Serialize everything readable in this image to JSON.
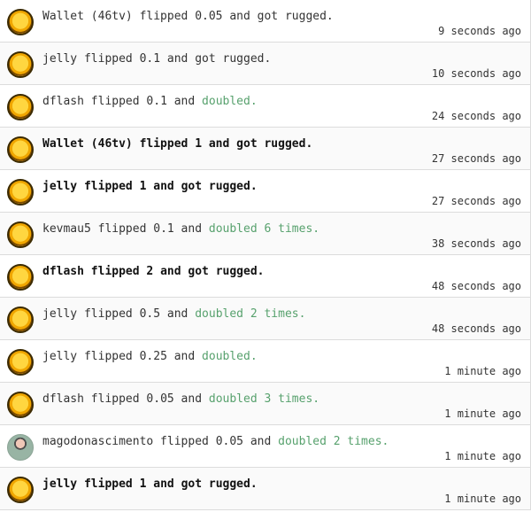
{
  "colors": {
    "doubled_text": "#57a16d",
    "coin": "#ffc21a",
    "divider": "#dcdcdc"
  },
  "feed": [
    {
      "icon": "coin-icon",
      "user": "Wallet (46tv)",
      "amount": "0.05",
      "verb_pre": " flipped ",
      "connector": " and ",
      "outcome": "got rugged.",
      "outcome_type": "rugged",
      "emphasis": false,
      "time": "9 seconds ago"
    },
    {
      "icon": "coin-icon",
      "user": "jelly",
      "amount": "0.1",
      "verb_pre": " flipped ",
      "connector": " and ",
      "outcome": "got rugged.",
      "outcome_type": "rugged",
      "emphasis": false,
      "time": "10 seconds ago"
    },
    {
      "icon": "coin-icon",
      "user": "dflash",
      "amount": "0.1",
      "verb_pre": " flipped ",
      "connector": " and ",
      "outcome": "doubled.",
      "outcome_type": "doubled",
      "emphasis": false,
      "time": "24 seconds ago"
    },
    {
      "icon": "coin-icon",
      "user": "Wallet (46tv)",
      "amount": "1",
      "verb_pre": " flipped ",
      "connector": " and ",
      "outcome": "got rugged.",
      "outcome_type": "rugged",
      "emphasis": true,
      "time": "27 seconds ago"
    },
    {
      "icon": "coin-icon",
      "user": "jelly",
      "amount": "1",
      "verb_pre": " flipped ",
      "connector": " and ",
      "outcome": "got rugged.",
      "outcome_type": "rugged",
      "emphasis": true,
      "time": "27 seconds ago"
    },
    {
      "icon": "coin-icon",
      "user": "kevmau5",
      "amount": "0.1",
      "verb_pre": " flipped ",
      "connector": " and ",
      "outcome": "doubled 6 times.",
      "outcome_type": "doubled",
      "emphasis": false,
      "time": "38 seconds ago"
    },
    {
      "icon": "coin-icon",
      "user": "dflash",
      "amount": "2",
      "verb_pre": " flipped ",
      "connector": " and ",
      "outcome": "got rugged.",
      "outcome_type": "rugged",
      "emphasis": true,
      "time": "48 seconds ago"
    },
    {
      "icon": "coin-icon",
      "user": "jelly",
      "amount": "0.5",
      "verb_pre": " flipped ",
      "connector": " and ",
      "outcome": "doubled 2 times.",
      "outcome_type": "doubled",
      "emphasis": false,
      "time": "48 seconds ago"
    },
    {
      "icon": "coin-icon",
      "user": "jelly",
      "amount": "0.25",
      "verb_pre": " flipped ",
      "connector": " and ",
      "outcome": "doubled.",
      "outcome_type": "doubled",
      "emphasis": false,
      "time": "1 minute ago"
    },
    {
      "icon": "coin-icon",
      "user": "dflash",
      "amount": "0.05",
      "verb_pre": " flipped ",
      "connector": " and ",
      "outcome": "doubled 3 times.",
      "outcome_type": "doubled",
      "emphasis": false,
      "time": "1 minute ago"
    },
    {
      "icon": "user-avatar",
      "user": "magodonascimento",
      "amount": "0.05",
      "verb_pre": " flipped ",
      "connector": " and ",
      "outcome": "doubled 2 times.",
      "outcome_type": "doubled",
      "emphasis": false,
      "time": "1 minute ago"
    },
    {
      "icon": "coin-icon",
      "user": "jelly",
      "amount": "1",
      "verb_pre": " flipped ",
      "connector": " and ",
      "outcome": "got rugged.",
      "outcome_type": "rugged",
      "emphasis": true,
      "time": "1 minute ago"
    }
  ]
}
